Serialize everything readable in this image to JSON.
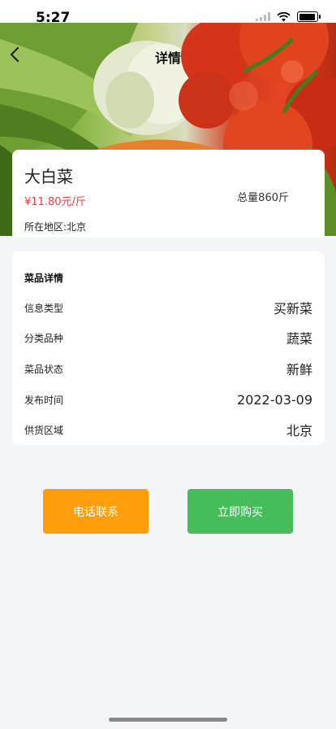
{
  "status_bar": {
    "time": "5:27",
    "icons": [
      "signal-icon",
      "wifi-icon",
      "battery-icon"
    ]
  },
  "nav": {
    "title": "详情",
    "back_icon": "chevron-left-icon"
  },
  "product": {
    "name": "大白菜",
    "price": "¥11.80元/斤",
    "total": "总量860斤",
    "region": "所在地区:北京"
  },
  "details": {
    "title": "菜品详情",
    "rows": [
      {
        "label": "信息类型",
        "value": "买新菜"
      },
      {
        "label": "分类品种",
        "value": "蔬菜"
      },
      {
        "label": "菜品状态",
        "value": "新鲜"
      },
      {
        "label": "发布时间",
        "value": "2022-03-09"
      },
      {
        "label": "供货区域",
        "value": "北京"
      }
    ]
  },
  "actions": {
    "call_label": "电话联系",
    "buy_label": "立即购买"
  },
  "colors": {
    "price": "#f23c3c",
    "call_button": "#ff9e0b",
    "buy_button": "#44bd5a",
    "background": "#f4f5f9"
  }
}
